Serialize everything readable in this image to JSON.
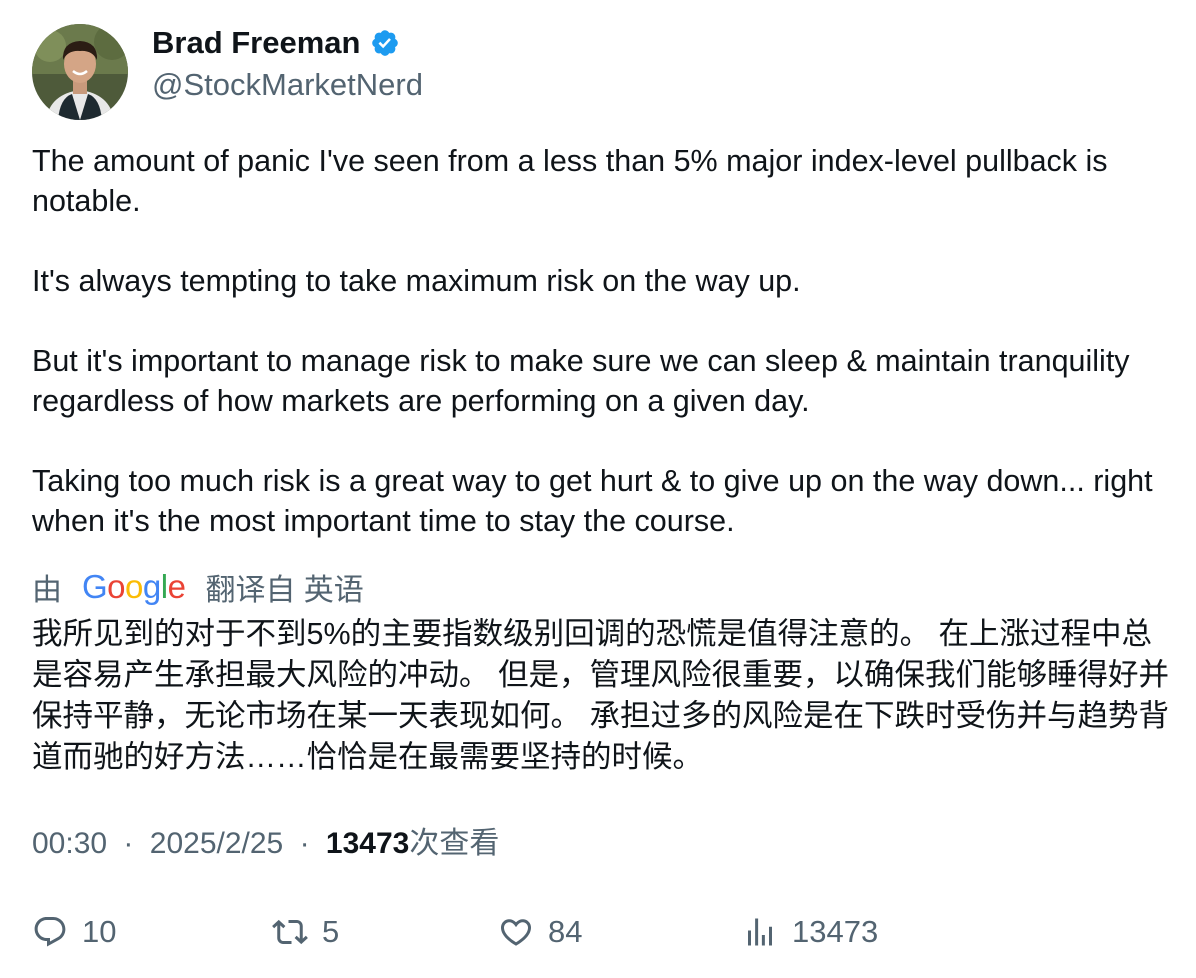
{
  "author": {
    "display_name": "Brad Freeman",
    "handle": "@StockMarketNerd",
    "verified": true,
    "verified_color": "#1d9bf0"
  },
  "tweet": {
    "paragraphs": [
      "The amount of panic I've seen from a less than 5% major index-level pullback is notable.",
      "It's always tempting to take maximum risk on the way up.",
      "But it's important to manage risk to make sure we can sleep & maintain tranquility regardless of how markets are performing on a given day.",
      "Taking too much risk is a great way to get hurt & to give up on the way down... right when it's the most important time to stay the course."
    ]
  },
  "translation": {
    "prefix": "由",
    "provider": "Google",
    "suffix": "翻译自 英语",
    "text": "我所见到的对于不到5%的主要指数级别回调的恐慌是值得注意的。 在上涨过程中总是容易产生承担最大风险的冲动。 但是，管理风险很重要，以确保我们能够睡得好并保持平静，无论市场在某一天表现如何。 承担过多的风险是在下跌时受伤并与趋势背道而驰的好方法……恰恰是在最需要坚持的时候。"
  },
  "meta": {
    "time": "00:30",
    "separator": "·",
    "date": "2025/2/25",
    "views_count": "13473",
    "views_label": "次查看"
  },
  "actions": {
    "reply_count": "10",
    "retweet_count": "5",
    "like_count": "84",
    "views_count": "13473"
  },
  "icons": {
    "reply": "reply-icon",
    "retweet": "retweet-icon",
    "like": "heart-icon",
    "views": "bar-chart-icon",
    "verified": "verified-badge-icon"
  },
  "colors": {
    "text_primary": "#0f1419",
    "text_secondary": "#536471",
    "google_blue": "#4285f4",
    "google_red": "#ea4335",
    "google_yellow": "#fbbc05",
    "google_green": "#34a853"
  }
}
